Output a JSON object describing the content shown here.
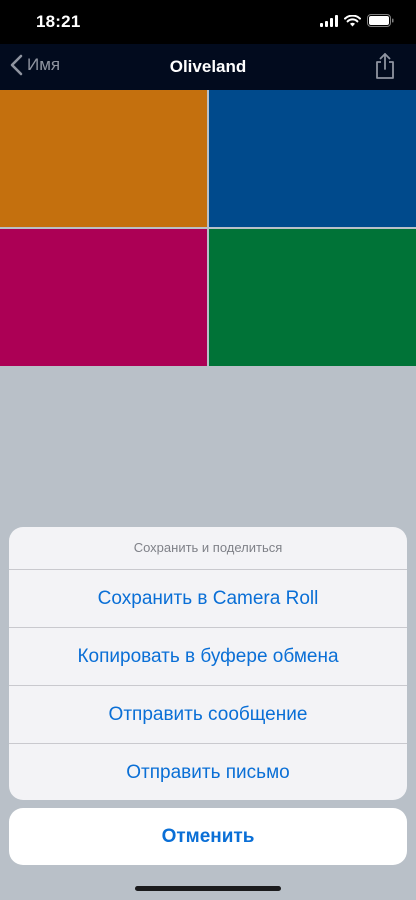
{
  "status_bar": {
    "time": "18:21"
  },
  "nav": {
    "back_label": "Имя",
    "title": "Oliveland"
  },
  "palette": {
    "colors": [
      "#c4700e",
      "#004a8c",
      "#ac0055",
      "#007337"
    ]
  },
  "action_sheet": {
    "title": "Сохранить и поделиться",
    "options": [
      "Сохранить в Camera Roll",
      "Копировать в буфере обмена",
      "Отправить сообщение",
      "Отправить письмо"
    ],
    "cancel_label": "Отменить"
  },
  "colors": {
    "accent": "#0a6fd6",
    "nav_background": "#020b1e",
    "dimmed_background": "#b9c0c8"
  }
}
